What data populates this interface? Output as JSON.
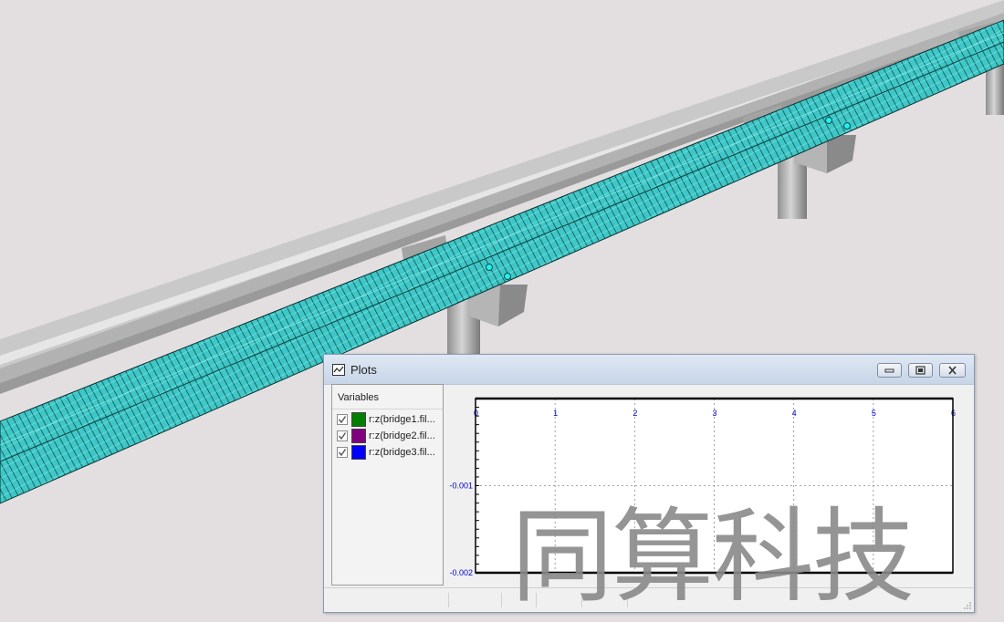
{
  "window": {
    "title": "Plots",
    "icon": "plot-icon",
    "buttons": [
      "minimize-icon",
      "maximize-icon",
      "close-icon"
    ]
  },
  "variables": {
    "header": "Variables",
    "items": [
      {
        "label": "r:z(bridge1.fil...",
        "color": "#008000",
        "checked": true
      },
      {
        "label": "r:z(bridge2.fil...",
        "color": "#800080",
        "checked": true
      },
      {
        "label": "r:z(bridge3.fil...",
        "color": "#0000ff",
        "checked": true
      }
    ]
  },
  "chart_data": {
    "type": "line",
    "x_ticks": [
      "0",
      "1",
      "2",
      "3",
      "4",
      "5",
      "6"
    ],
    "y_ticks": [
      "-0.001",
      "-0.002"
    ],
    "xlim": [
      0,
      6
    ],
    "ylim": [
      -0.002,
      0
    ],
    "grid": true,
    "tick_color": "#0000cc",
    "series": [
      {
        "label_ref": "r:z(bridge1.fil...",
        "color": "#008000",
        "x": [],
        "y": []
      },
      {
        "label_ref": "r:z(bridge2.fil...",
        "color": "#800080",
        "x": [],
        "y": []
      },
      {
        "label_ref": "r:z(bridge3.fil...",
        "color": "#0000ff",
        "x": [],
        "y": []
      }
    ]
  },
  "scene": {
    "background": "#e3dfe1",
    "mesh_color": "#3ecdcd",
    "rail_color": "#bdbdbd",
    "pier_color": "#9c9c9c"
  },
  "watermark": "同算科技"
}
